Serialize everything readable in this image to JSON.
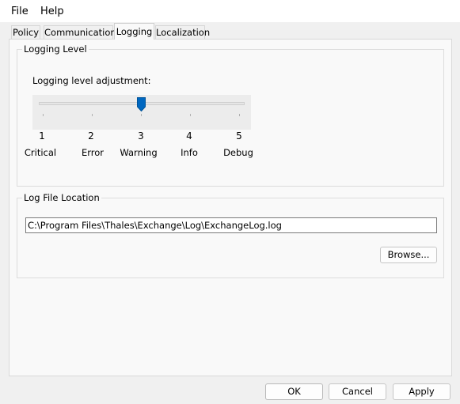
{
  "menu": {
    "file": "File",
    "help": "Help"
  },
  "tabs": [
    {
      "label": "Policy"
    },
    {
      "label": "Communications"
    },
    {
      "label": "Logging",
      "active": true
    },
    {
      "label": "Localization"
    }
  ],
  "logging_level": {
    "group_title": "Logging Level",
    "adjust_label": "Logging level adjustment:",
    "slider_value": 3,
    "ticks": [
      {
        "num": "1",
        "name": "Critical"
      },
      {
        "num": "2",
        "name": "Error"
      },
      {
        "num": "3",
        "name": "Warning"
      },
      {
        "num": "4",
        "name": "Info"
      },
      {
        "num": "5",
        "name": "Debug"
      }
    ]
  },
  "log_file": {
    "group_title": "Log File Location",
    "path": "C:\\Program Files\\Thales\\Exchange\\Log\\ExchangeLog.log",
    "browse_label": "Browse..."
  },
  "buttons": {
    "ok": "OK",
    "cancel": "Cancel",
    "apply": "Apply"
  },
  "colors": {
    "accent": "#0067c0",
    "background": "#f0f0f0"
  }
}
